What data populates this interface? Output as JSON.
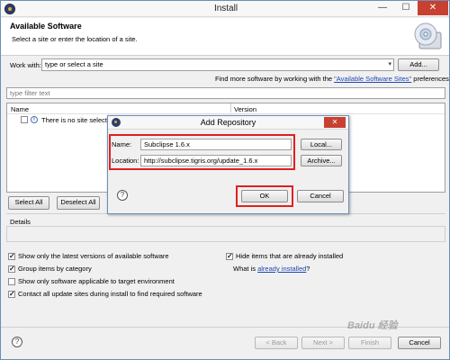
{
  "window": {
    "title": "Install",
    "min_glyph": "—",
    "max_glyph": "☐",
    "close_glyph": "✕"
  },
  "banner": {
    "heading": "Available Software",
    "subtext": "Select a site or enter the location of a site."
  },
  "work_with": {
    "label": "Work with:",
    "value": "type or select a site",
    "add_button": "Add..."
  },
  "more_software": {
    "prefix": "Find more software by working with the ",
    "link": "\"Available Software Sites\"",
    "suffix": " preferences."
  },
  "filter": {
    "placeholder": "type filter text"
  },
  "table": {
    "columns": [
      "Name",
      "Version"
    ],
    "rows": [
      {
        "text": "There is no site selecte",
        "checked": false
      }
    ]
  },
  "selection_buttons": {
    "select_all": "Select All",
    "deselect_all": "Deselect All"
  },
  "details": {
    "label": "Details"
  },
  "options": [
    {
      "label": "Show only the latest versions of available software",
      "checked": true
    },
    {
      "label": "Group items by category",
      "checked": true
    },
    {
      "label": "Show only software applicable to target environment",
      "checked": false
    },
    {
      "label": "Contact all update sites during install to find required software",
      "checked": true
    }
  ],
  "right_options": {
    "hide_installed": {
      "label": "Hide items that are already installed",
      "checked": true
    },
    "what_is": "What is ",
    "already_installed_link": "already installed",
    "question": "?"
  },
  "footer": {
    "help": "?",
    "back": "< Back",
    "next": "Next >",
    "finish": "Finish",
    "cancel": "Cancel"
  },
  "dialog": {
    "title": "Add Repository",
    "close_glyph": "✕",
    "name_label": "Name:",
    "name_value": "Subclipse 1.6.x",
    "location_label": "Location:",
    "location_value": "http://subclipse.tigris.org/update_1.6.x",
    "local_button": "Local...",
    "archive_button": "Archive...",
    "help": "?",
    "ok_button": "OK",
    "cancel_button": "Cancel"
  },
  "watermark": "Baidu 经验",
  "colors": {
    "highlight": "#e02020",
    "link": "#1e48b4",
    "close_button": "#c84031"
  }
}
